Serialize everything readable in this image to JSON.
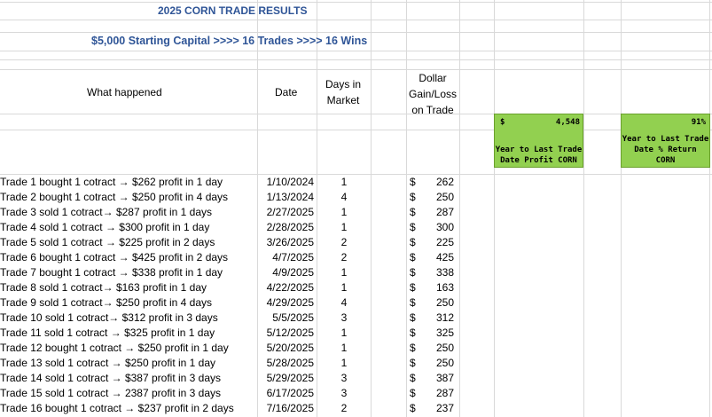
{
  "title": "2025 CORN TRADE RESULTS",
  "subtitle": "$5,000 Starting Capital >>>> 16 Trades >>>> 16 Wins",
  "headers": {
    "what": "What happened",
    "date": "Date",
    "days_l1": "Days in",
    "days_l2": "Market",
    "dollar_l1": "Dollar",
    "dollar_l2": "Gain/Loss",
    "dollar_l3": "on Trade"
  },
  "profit_box": {
    "currency": "$",
    "value": "4,548",
    "label_l1": "Year to Last Trade",
    "label_l2": "Date Profit CORN"
  },
  "return_box": {
    "value": "91%",
    "label_l1": "Year to Last Trade",
    "label_l2": "Date % Return",
    "label_l3": "CORN"
  },
  "rows": [
    {
      "what": "Trade 1 bought 1 cotract → $262 profit in 1 day",
      "date": "1/10/2024",
      "days": "1",
      "cur": "$",
      "amt": "262"
    },
    {
      "what": "Trade 2 bought 1 cotract → $250 profit in 4 days",
      "date": "1/13/2024",
      "days": "4",
      "cur": "$",
      "amt": "250"
    },
    {
      "what": "Trade 3 sold 1 cotract→ $287 profit in 1 days",
      "date": "2/27/2025",
      "days": "1",
      "cur": "$",
      "amt": "287"
    },
    {
      "what": "Trade 4 sold 1 cotract → $300 profit in 1 day",
      "date": "2/28/2025",
      "days": "1",
      "cur": "$",
      "amt": "300"
    },
    {
      "what": "Trade 5 sold 1 cotract → $225 profit in 2 days",
      "date": "3/26/2025",
      "days": "2",
      "cur": "$",
      "amt": "225"
    },
    {
      "what": "Trade 6 bought 1 cotract → $425 profit in 2 days",
      "date": "4/7/2025",
      "days": "2",
      "cur": "$",
      "amt": "425"
    },
    {
      "what": "Trade 7 bought 1 cotract → $338 profit in 1 day",
      "date": "4/9/2025",
      "days": "1",
      "cur": "$",
      "amt": "338"
    },
    {
      "what": "Trade 8 sold 1 cotract→ $163 profit in 1 day",
      "date": "4/22/2025",
      "days": "1",
      "cur": "$",
      "amt": "163"
    },
    {
      "what": "Trade 9 sold 1 cotract→ $250 profit in 4 days",
      "date": "4/29/2025",
      "days": "4",
      "cur": "$",
      "amt": "250"
    },
    {
      "what": "Trade 10 sold 1 cotract→ $312 profit in 3 days",
      "date": "5/5/2025",
      "days": "3",
      "cur": "$",
      "amt": "312"
    },
    {
      "what": "Trade 11 sold 1 cotract → $325 profit in 1 day",
      "date": "5/12/2025",
      "days": "1",
      "cur": "$",
      "amt": "325"
    },
    {
      "what": "Trade 12 bought 1 cotract → $250 profit in 1 day",
      "date": "5/20/2025",
      "days": "1",
      "cur": "$",
      "amt": "250"
    },
    {
      "what": "Trade 13 sold 1 cotract → $250 profit in 1 day",
      "date": "5/28/2025",
      "days": "1",
      "cur": "$",
      "amt": "250"
    },
    {
      "what": "Trade 14 sold 1 cotract → $387 profit in 3 days",
      "date": "5/29/2025",
      "days": "3",
      "cur": "$",
      "amt": "387"
    },
    {
      "what": "Trade 15 sold 1 cotract → 2387 profit in 3 days",
      "date": "6/17/2025",
      "days": "3",
      "cur": "$",
      "amt": "287"
    },
    {
      "what": "Trade 16 bought 1 cotract → $237 profit in 2 days",
      "date": "7/16/2025",
      "days": "2",
      "cur": "$",
      "amt": "237"
    }
  ]
}
